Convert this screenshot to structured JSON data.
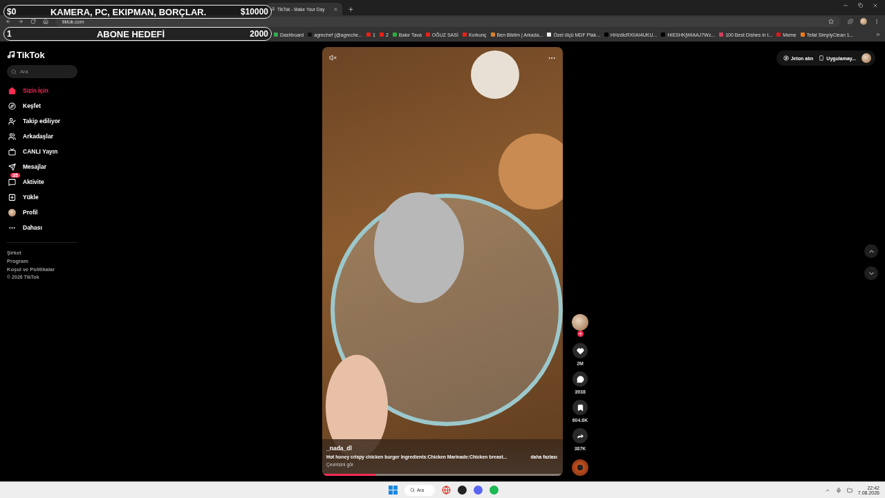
{
  "stream_overlay": [
    {
      "start": "$0",
      "label": "KAMERA, PC, EKIPMAN, BORÇLAR.",
      "end": "$10000"
    },
    {
      "start": "1",
      "label": "ABONE HEDEFİ",
      "end": "2000"
    }
  ],
  "browser": {
    "tabs": [
      {
        "title": "TikTok - Make Your Day",
        "selected": true
      }
    ],
    "url": "tiktok.com",
    "bookmarks": [
      {
        "label": "Dashboard",
        "color": "#34a853"
      },
      {
        "label": "agrechef (@agreche...",
        "color": "#111111"
      },
      {
        "label": "1",
        "color": "#e62117"
      },
      {
        "label": "2",
        "color": "#e62117"
      },
      {
        "label": "Bakır Tava",
        "color": "#2eab3a"
      },
      {
        "label": "OĞUZ SASİ",
        "color": "#e62117"
      },
      {
        "label": "Korkunç",
        "color": "#e62117"
      },
      {
        "label": "Ben Bildim | Arkada...",
        "color": "#d9822b"
      },
      {
        "label": "Özel ölçü MDF Plak...",
        "color": "#eeeeee"
      },
      {
        "label": "HHzdlcRX0AI4UKU...",
        "color": "#000000"
      },
      {
        "label": "HIESHKjWIAAJ7Wz...",
        "color": "#000000"
      },
      {
        "label": "100 Best Dishes in t...",
        "color": "#d0405a"
      },
      {
        "label": "Meme",
        "color": "#d81b1b"
      },
      {
        "label": "Tefal SimplyClean 1...",
        "color": "#f07a1a"
      }
    ]
  },
  "sidebar": {
    "logo": "TikTok",
    "search": {
      "placeholder": "Ara"
    },
    "items": [
      {
        "kind": "home",
        "label": "Sizin İçin",
        "selected": true
      },
      {
        "kind": "explore",
        "label": "Keşfet",
        "selected": false
      },
      {
        "kind": "following",
        "label": "Takip ediliyor",
        "selected": false
      },
      {
        "kind": "friends",
        "label": "Arkadaşlar",
        "selected": false
      },
      {
        "kind": "live",
        "label": "CANLI Yayın",
        "selected": false
      },
      {
        "kind": "messages",
        "label": "Mesajlar",
        "selected": false
      },
      {
        "kind": "activity",
        "label": "Aktivite",
        "selected": false,
        "badge": "35"
      },
      {
        "kind": "upload",
        "label": "Yükle",
        "selected": false
      },
      {
        "kind": "profile",
        "label": "Profil",
        "selected": false
      },
      {
        "kind": "more",
        "label": "Dahası",
        "selected": false
      }
    ],
    "footer": [
      "Şirket",
      "Program",
      "Koşul ve Politikalar",
      "© 2026 TikTok"
    ]
  },
  "header": {
    "coins": "Jeton alın",
    "app": "Uygulamay..."
  },
  "video": {
    "author": "_nada_dl",
    "caption": "Hot honey crispy chicken burger Ingredients:Chicken Marinade:Chicken breast...",
    "more": "daha fazlası",
    "translate": "Çevirisini gör",
    "level": 0.22
  },
  "actions": [
    {
      "kind": "like",
      "count": "2M"
    },
    {
      "kind": "comment",
      "count": "3938"
    },
    {
      "kind": "save",
      "count": "604.6K"
    },
    {
      "kind": "share",
      "count": "387K"
    }
  ],
  "taskbar": {
    "search": "Ara",
    "time": "22:42",
    "date": "7.08.2026"
  }
}
